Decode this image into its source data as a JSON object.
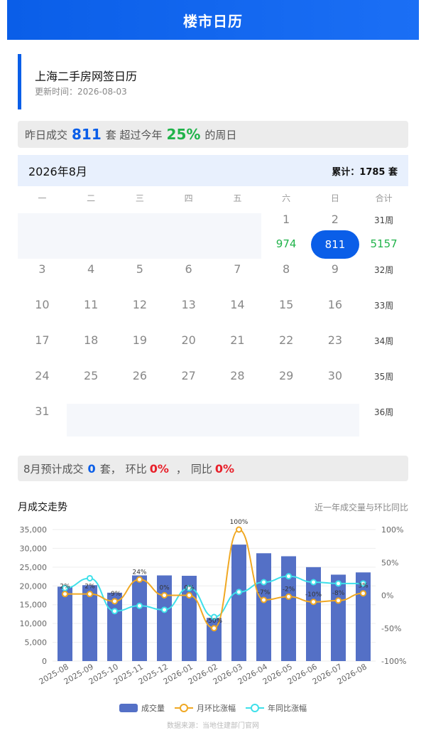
{
  "header": {
    "title": "楼市日历"
  },
  "title_block": {
    "title": "上海二手房网签日历",
    "updated": "更新时间：2026-08-03"
  },
  "summary": {
    "prefix": "昨日成交",
    "count": "811",
    "unit": "套 超过今年",
    "pct": "25%",
    "suffix": "的周日"
  },
  "calendar": {
    "month": "2026年8月",
    "total": "累计：1785 套",
    "weekdays": [
      "一",
      "二",
      "三",
      "四",
      "五",
      "六",
      "日",
      "合计"
    ],
    "day1": "1",
    "day1_count": "974",
    "day2": "2",
    "day2_count": "811",
    "week31_label": "31周",
    "week31_total": "5157",
    "rows": [
      {
        "days": [
          "3",
          "4",
          "5",
          "6",
          "7",
          "8",
          "9"
        ],
        "week": "32周"
      },
      {
        "days": [
          "10",
          "11",
          "12",
          "13",
          "14",
          "15",
          "16"
        ],
        "week": "33周"
      },
      {
        "days": [
          "17",
          "18",
          "19",
          "20",
          "21",
          "22",
          "23"
        ],
        "week": "34周"
      },
      {
        "days": [
          "24",
          "25",
          "26",
          "27",
          "28",
          "29",
          "30"
        ],
        "week": "35周"
      },
      {
        "days": [
          "31"
        ],
        "week": "36周"
      }
    ]
  },
  "forecast": {
    "prefix": "8月预计成交",
    "count": "0",
    "unit": "套，",
    "mom_label": "环比",
    "mom": "0%",
    "sep": "，",
    "yoy_label": "同比",
    "yoy": "0%"
  },
  "trend": {
    "title": "月成交走势",
    "subtitle": "近一年成交量与环比同比"
  },
  "chart_data": {
    "type": "bar",
    "categories": [
      "2025-08",
      "2025-09",
      "2025-10",
      "2025-11",
      "2025-12",
      "2026-01",
      "2026-02",
      "2026-03",
      "2026-04",
      "2026-05",
      "2026-06",
      "2026-07",
      "2026-08"
    ],
    "series": [
      {
        "name": "成交量",
        "type": "bar",
        "axis": "left",
        "values": [
          19800,
          20200,
          18200,
          22800,
          22800,
          22700,
          11500,
          31000,
          28700,
          27900,
          25000,
          23000,
          23600
        ]
      },
      {
        "name": "月环比涨幅",
        "type": "line",
        "axis": "right",
        "values": [
          2,
          2,
          -9,
          24,
          0,
          0,
          -50,
          100,
          -7,
          -2,
          -10,
          -8,
          3
        ]
      },
      {
        "name": "年同比涨幅",
        "type": "line",
        "axis": "right",
        "values": [
          11,
          26,
          -24,
          -16,
          -22,
          11,
          -33,
          5,
          20,
          29,
          20,
          18,
          18
        ]
      }
    ],
    "mom_labels": [
      "2%",
      "2%",
      "-9%",
      "24%",
      "0%",
      "0%",
      "-50%",
      "100%",
      "-7%",
      "-2%",
      "-10%",
      "-8%",
      "3%"
    ],
    "left_ticks": [
      "35,000",
      "30,000",
      "25,000",
      "20,000",
      "15,000",
      "10,000",
      "5,000",
      "0"
    ],
    "right_ticks": [
      "100%",
      "50%",
      "0%",
      "-50%",
      "-100%"
    ],
    "ylim_left": [
      0,
      35000
    ],
    "ylim_right": [
      -100,
      100
    ],
    "colors": {
      "bar": "#5470c6",
      "mom": "#f0a823",
      "yoy": "#3ee0ea"
    }
  },
  "footer": {
    "source": "数据来源：当地住建部门官网"
  }
}
